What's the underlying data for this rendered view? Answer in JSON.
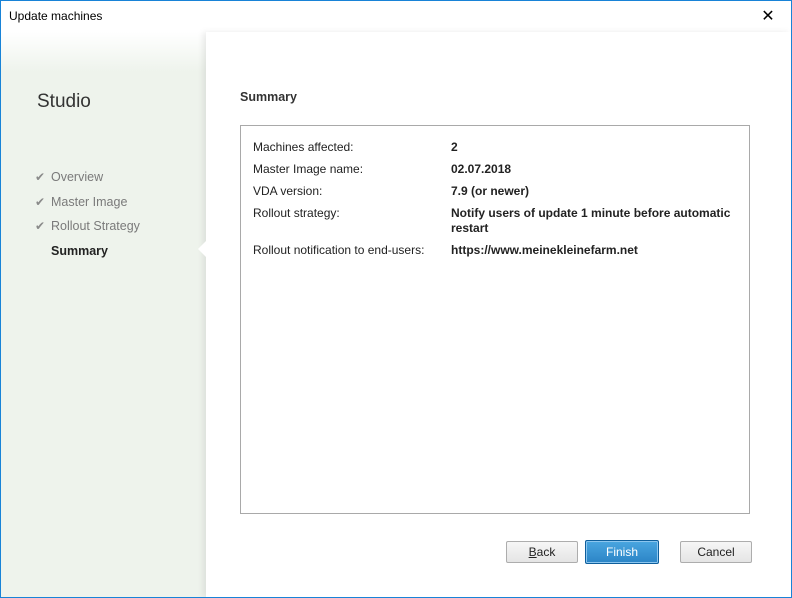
{
  "window": {
    "title": "Update machines",
    "close_glyph": "✕"
  },
  "sidebar": {
    "brand": "Studio",
    "steps": [
      {
        "label": "Overview",
        "state": "done",
        "icon": "check-icon"
      },
      {
        "label": "Master Image",
        "state": "done",
        "icon": "check-icon"
      },
      {
        "label": "Rollout Strategy",
        "state": "done",
        "icon": "check-icon"
      },
      {
        "label": "Summary",
        "state": "current"
      }
    ],
    "check_glyph": "✔"
  },
  "main": {
    "title": "Summary",
    "rows": [
      {
        "key": "Machines affected:",
        "value": "2"
      },
      {
        "key": "Master Image name:",
        "value": "02.07.2018"
      },
      {
        "key": "VDA version:",
        "value": "7.9 (or newer)"
      },
      {
        "key": "Rollout strategy:",
        "value": "Notify users of update 1 minute before automatic restart"
      },
      {
        "key": "Rollout notification to end-users:",
        "value": "https://www.meinekleinefarm.net"
      }
    ]
  },
  "buttons": {
    "back_accel": "B",
    "back_rest": "ack",
    "finish": "Finish",
    "cancel": "Cancel"
  },
  "colors": {
    "window_border": "#1883d7",
    "sidebar_bg": "#eef3ec",
    "primary_button": "#2b84c6"
  }
}
